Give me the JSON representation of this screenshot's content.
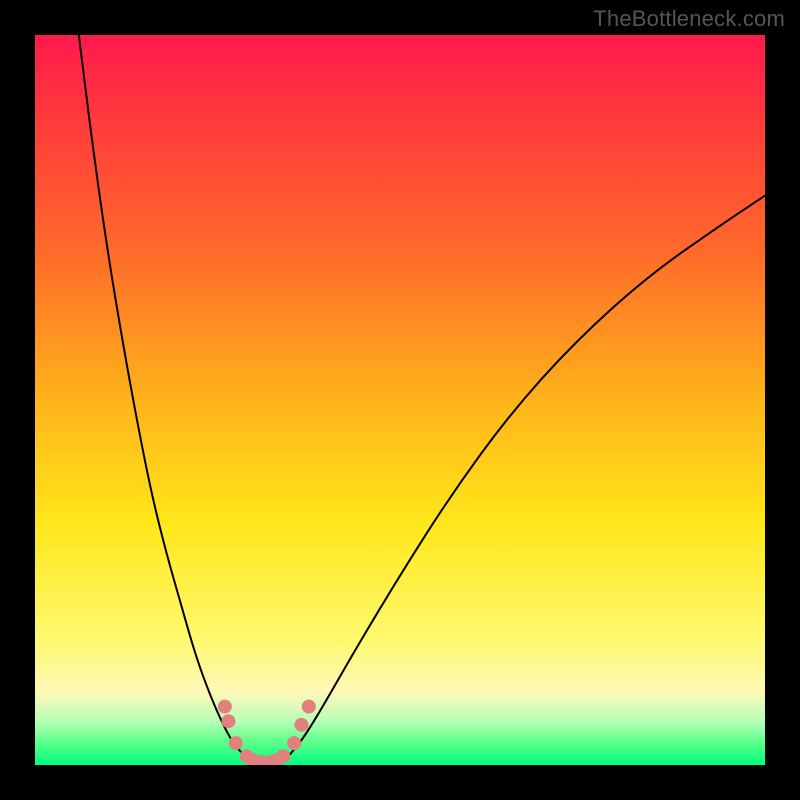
{
  "watermark": "TheBottleneck.com",
  "chart_data": {
    "type": "line",
    "title": "",
    "xlabel": "",
    "ylabel": "",
    "xlim": [
      0,
      100
    ],
    "ylim": [
      0,
      100
    ],
    "grid": false,
    "background": "gradient-red-to-green-vertical",
    "series": [
      {
        "name": "left-branch",
        "x": [
          6,
          8,
          10,
          12,
          14,
          16,
          18,
          20,
          22,
          24,
          26,
          27.5,
          29,
          30
        ],
        "values": [
          100,
          84,
          70,
          58,
          47,
          37,
          29,
          22,
          15,
          9.5,
          5,
          2.5,
          1,
          0.5
        ]
      },
      {
        "name": "right-branch",
        "x": [
          34,
          35,
          37,
          40,
          44,
          50,
          57,
          65,
          74,
          84,
          94,
          100
        ],
        "values": [
          0.5,
          1.5,
          4,
          9,
          16,
          26,
          37,
          48,
          58,
          67,
          74,
          78
        ]
      }
    ],
    "markers": [
      {
        "x": 26.0,
        "y": 8.0
      },
      {
        "x": 26.5,
        "y": 6.0
      },
      {
        "x": 27.5,
        "y": 3.0
      },
      {
        "x": 29.0,
        "y": 1.2
      },
      {
        "x": 30.0,
        "y": 0.6
      },
      {
        "x": 31.0,
        "y": 0.4
      },
      {
        "x": 32.0,
        "y": 0.4
      },
      {
        "x": 33.0,
        "y": 0.6
      },
      {
        "x": 34.0,
        "y": 1.2
      },
      {
        "x": 35.5,
        "y": 3.0
      },
      {
        "x": 36.5,
        "y": 5.5
      },
      {
        "x": 37.5,
        "y": 8.0
      }
    ],
    "marker_color": "#e28080",
    "curve_color": "#000000"
  }
}
